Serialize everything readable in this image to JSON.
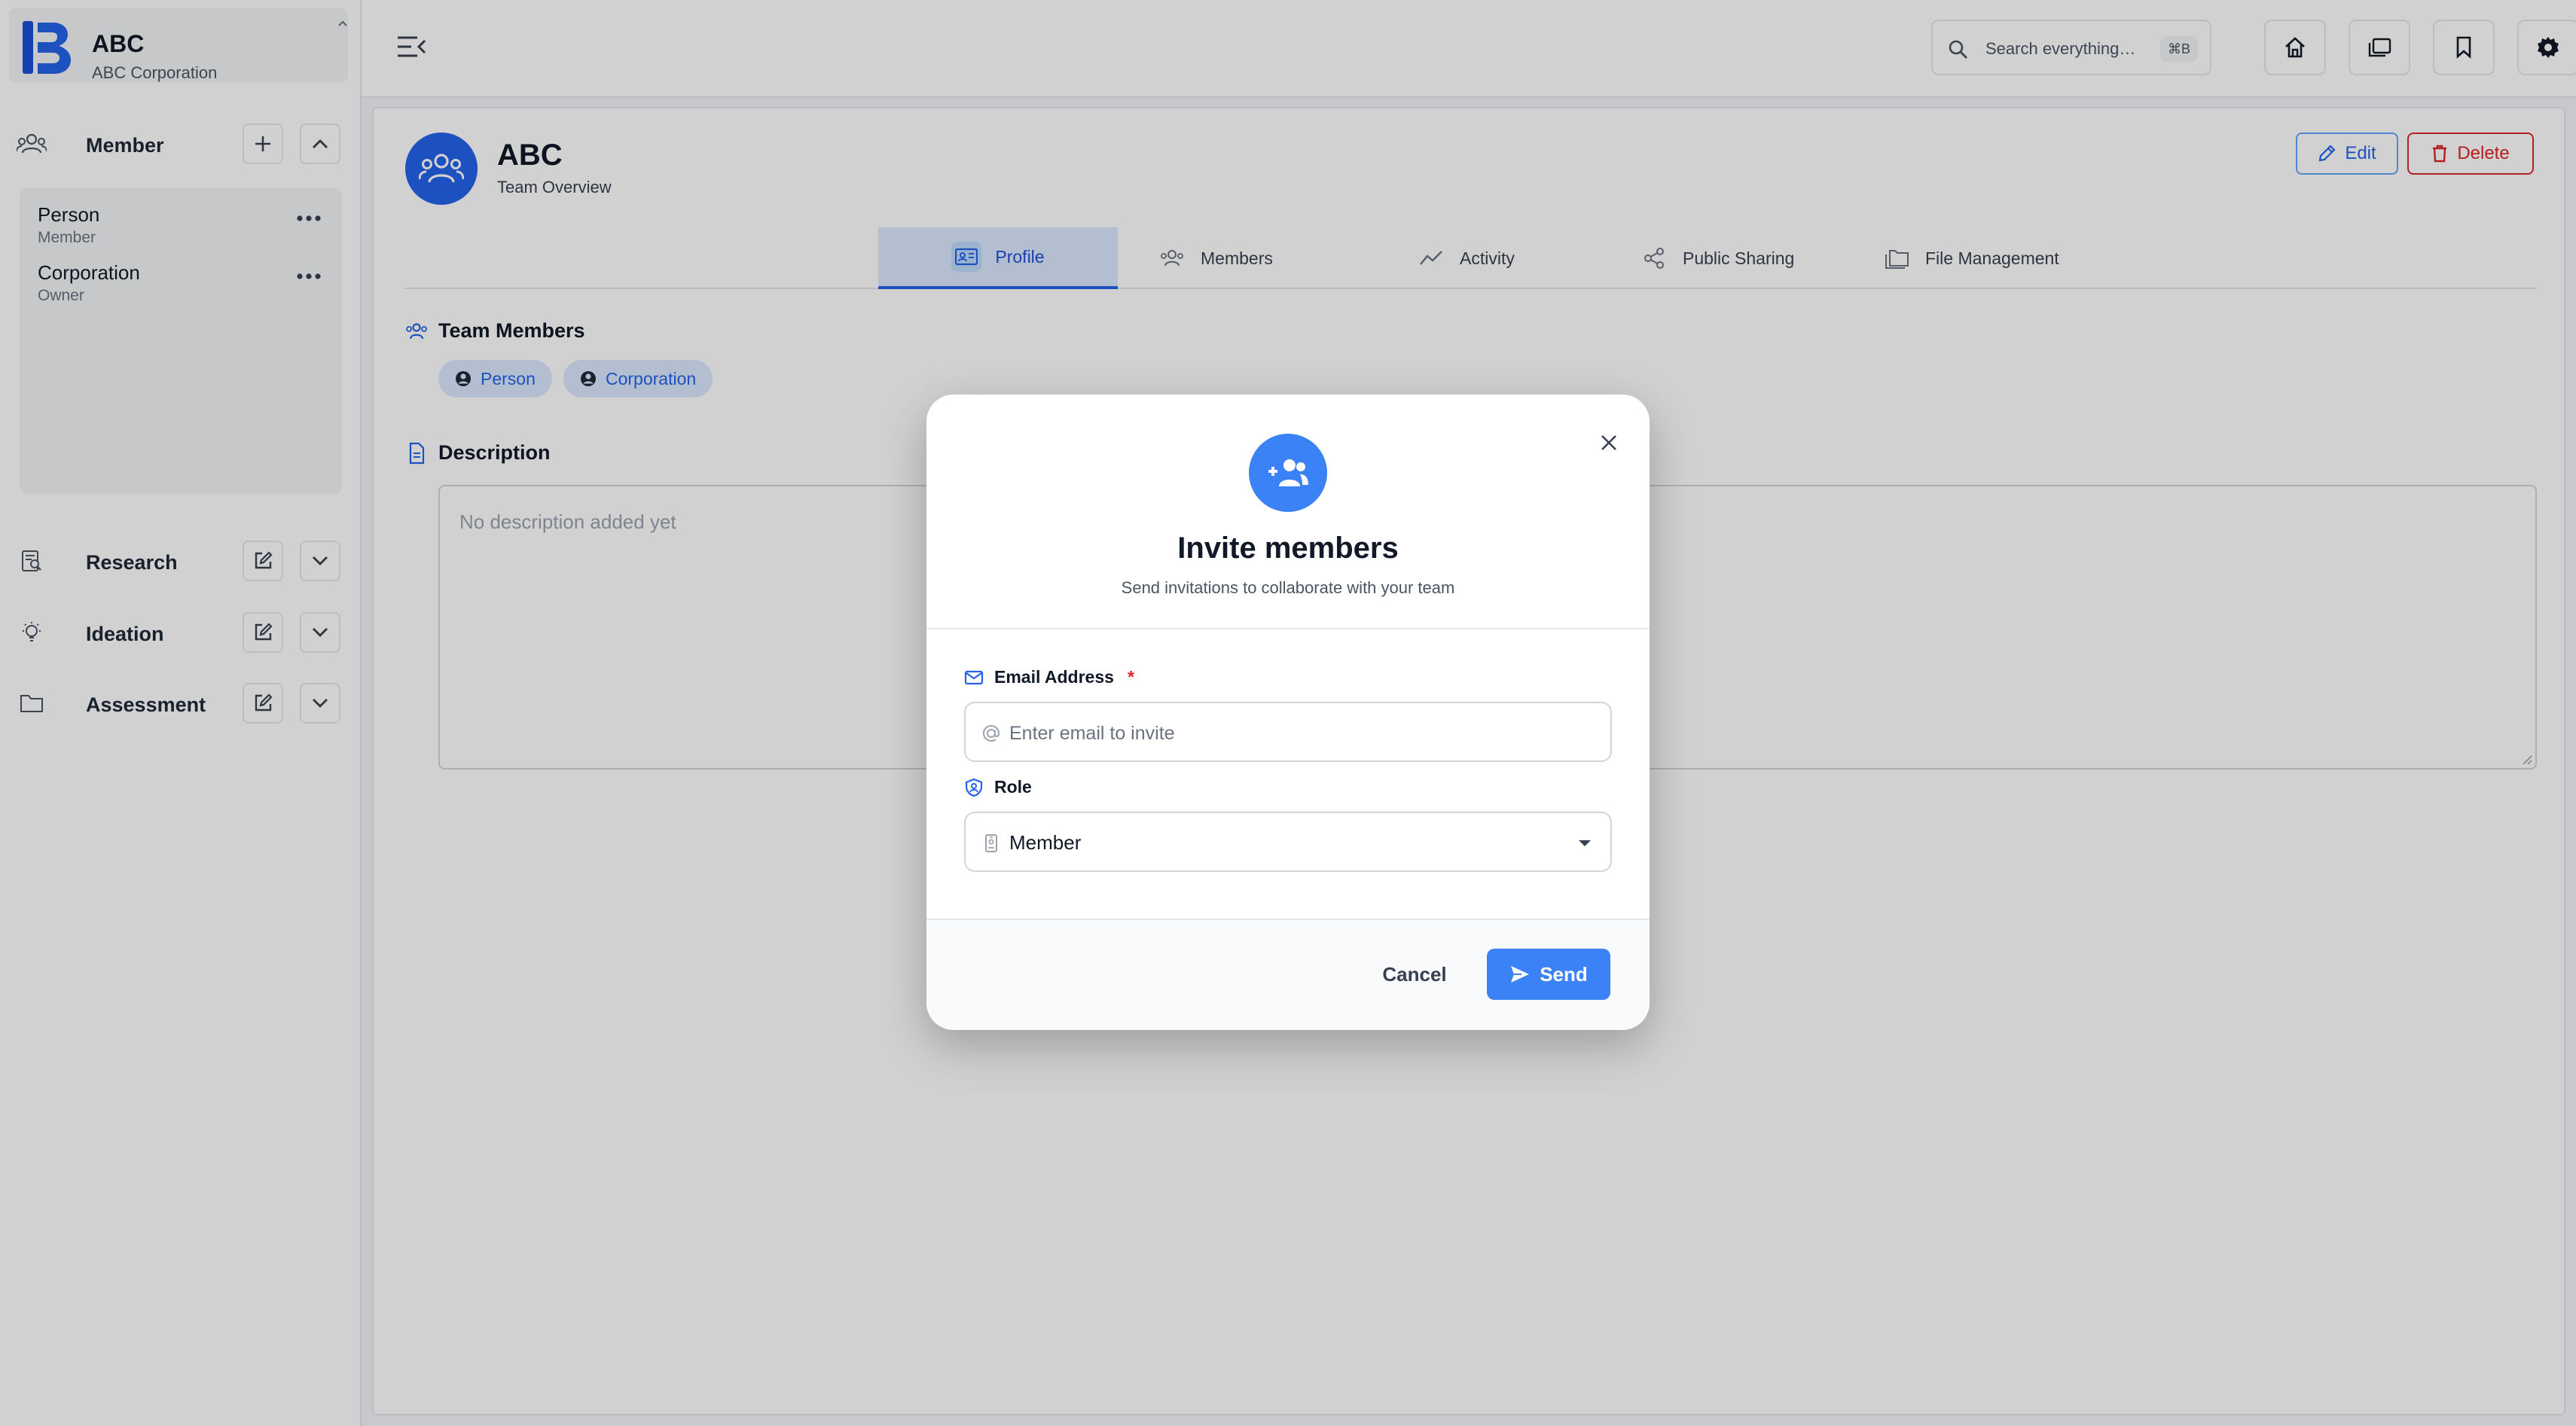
{
  "sidebar": {
    "brand": {
      "title": "ABC",
      "subtitle": "ABC Corporation"
    },
    "member_section": {
      "label": "Member"
    },
    "members": [
      {
        "name": "Person",
        "role": "Member"
      },
      {
        "name": "Corporation",
        "role": "Owner"
      }
    ],
    "sections": [
      {
        "label": "Research"
      },
      {
        "label": "Ideation"
      },
      {
        "label": "Assessment"
      }
    ]
  },
  "topbar": {
    "search_placeholder": "Search everything…",
    "search_shortcut": "⌘B"
  },
  "team": {
    "name": "ABC",
    "subtitle": "Team Overview",
    "edit_label": "Edit",
    "delete_label": "Delete"
  },
  "tabs": [
    {
      "label": "Profile",
      "active": true
    },
    {
      "label": "Members"
    },
    {
      "label": "Activity"
    },
    {
      "label": "Public Sharing"
    },
    {
      "label": "File Management"
    }
  ],
  "team_members": {
    "heading": "Team Members",
    "chips": [
      "Person",
      "Corporation"
    ]
  },
  "description": {
    "heading": "Description",
    "placeholder": "No description added yet"
  },
  "modal": {
    "title": "Invite members",
    "subtitle": "Send invitations to collaborate with your team",
    "email_label": "Email Address",
    "email_required_mark": "*",
    "email_placeholder": "Enter email to invite",
    "role_label": "Role",
    "role_value": "Member",
    "cancel_label": "Cancel",
    "send_label": "Send"
  },
  "colors": {
    "accent": "#3b82f6",
    "danger": "#dc2626",
    "overlay": "rgba(0,0,0,0.18)"
  }
}
